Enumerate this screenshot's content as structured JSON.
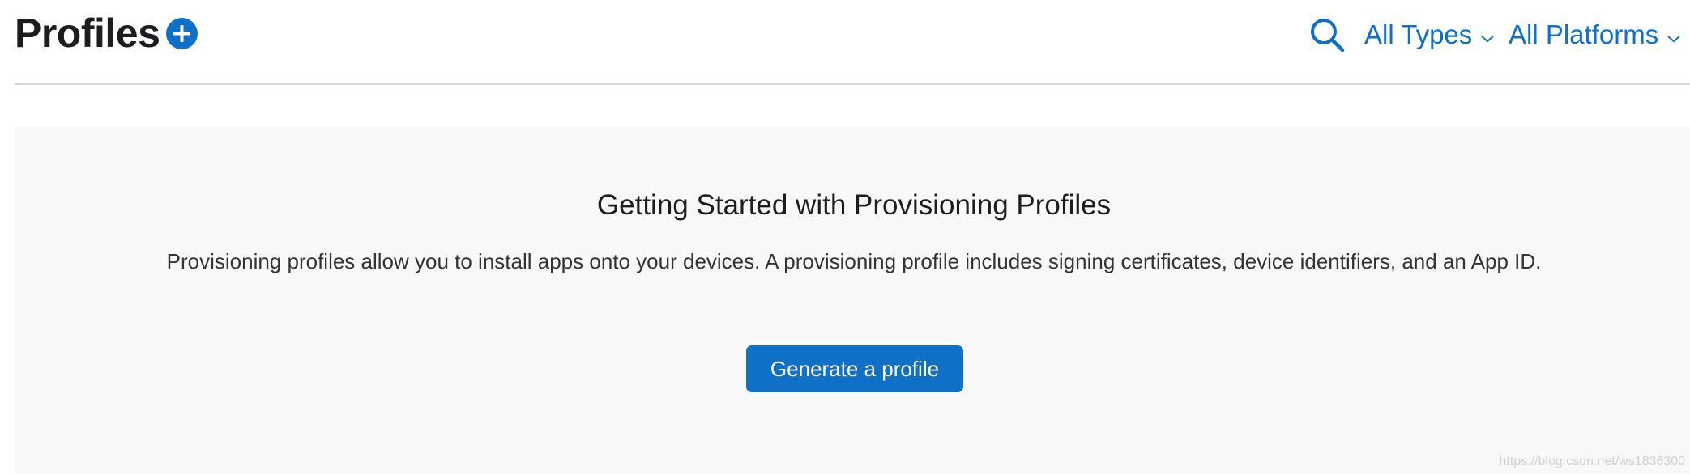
{
  "header": {
    "title": "Profiles",
    "filters": {
      "types_label": "All Types",
      "platforms_label": "All Platforms"
    }
  },
  "icons": {
    "add": "plus-circle-icon",
    "search": "search-icon",
    "chevron": "chevron-down-icon"
  },
  "empty_state": {
    "heading": "Getting Started with Provisioning Profiles",
    "description": "Provisioning profiles allow you to install apps onto your devices. A provisioning profile includes signing certificates, device identifiers, and an App ID.",
    "button_label": "Generate a profile"
  },
  "watermark": "https://blog.csdn.net/ws1836300",
  "colors": {
    "accent": "#0f70c7",
    "panel_background": "#f8f8f8",
    "divider": "#d7d7d9",
    "text": "#1d1d1f"
  }
}
